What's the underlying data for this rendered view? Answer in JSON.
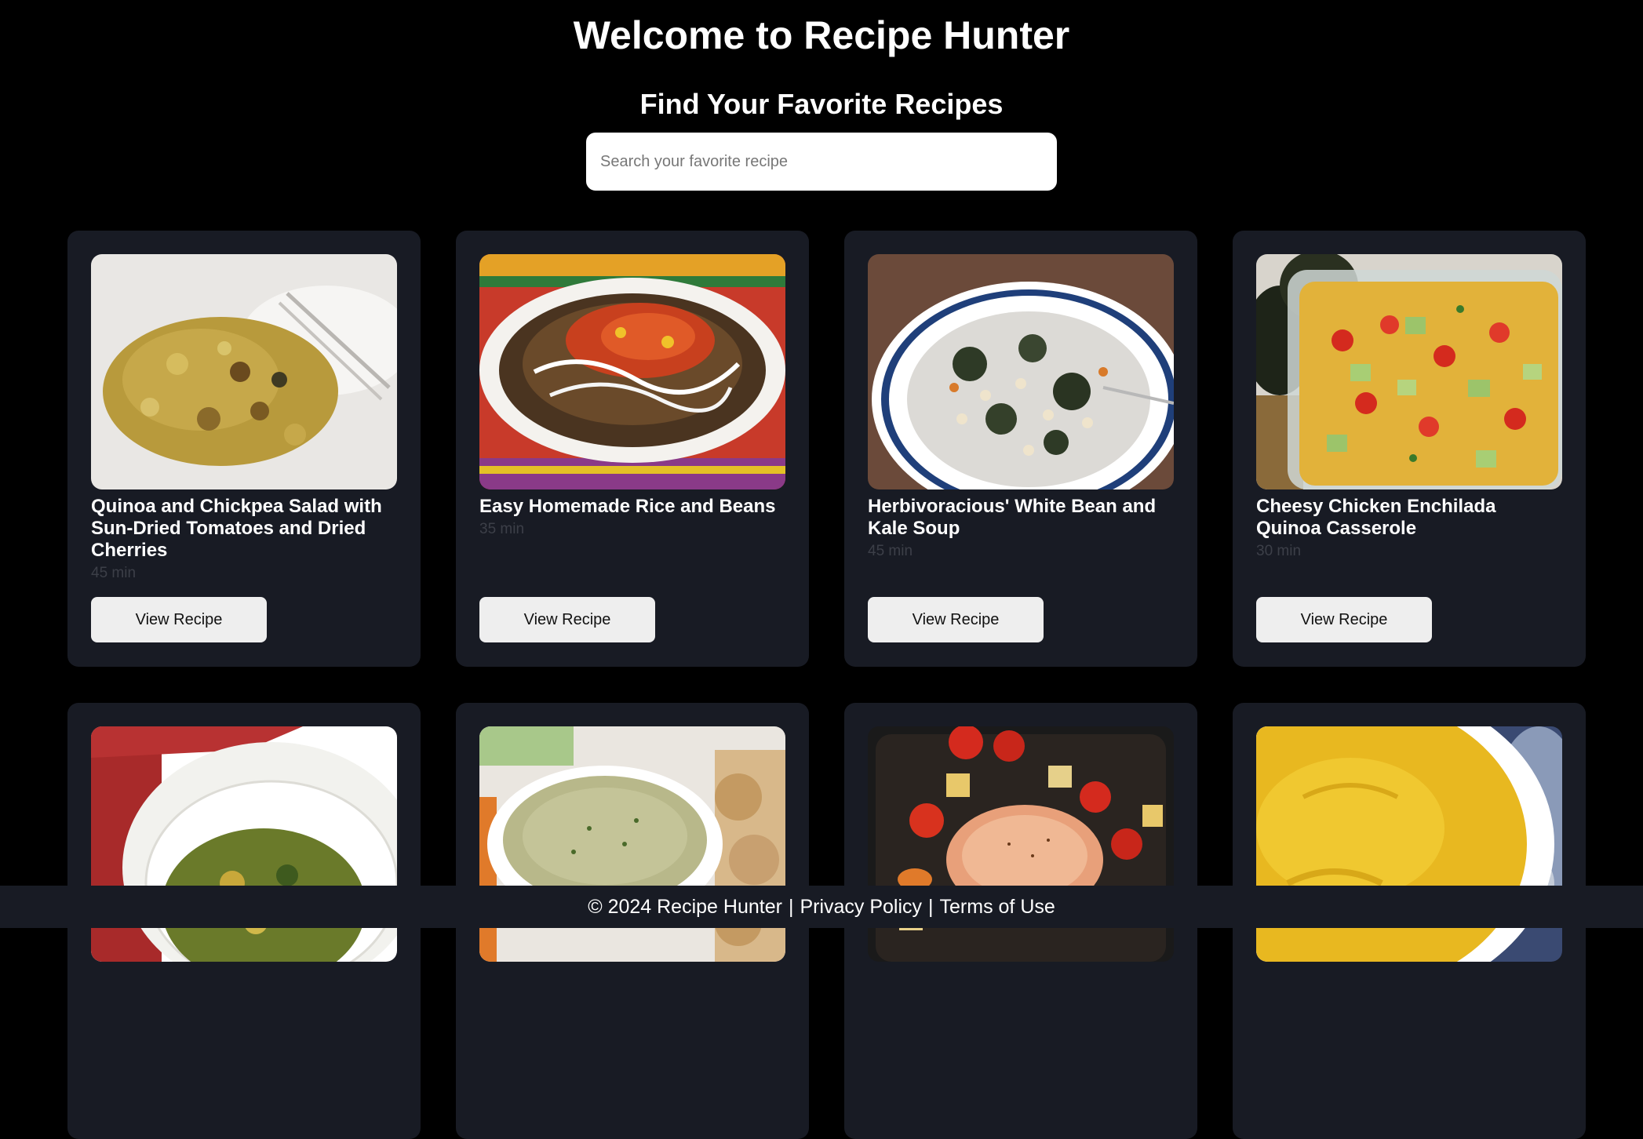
{
  "header": {
    "title": "Welcome to Recipe Hunter",
    "subtitle": "Find Your Favorite Recipes"
  },
  "search": {
    "placeholder": "Search your favorite recipe",
    "value": ""
  },
  "recipes": [
    {
      "title": "Quinoa and Chickpea Salad with Sun-Dried Tomatoes and Dried Cherries",
      "time": "45 min",
      "button": "View Recipe",
      "image": "quinoa-chickpea-salad-image"
    },
    {
      "title": "Easy Homemade Rice and Beans",
      "time": "35 min",
      "button": "View Recipe",
      "image": "rice-and-beans-image"
    },
    {
      "title": "Herbivoracious' White Bean and Kale Soup",
      "time": "45 min",
      "button": "View Recipe",
      "image": "white-bean-kale-soup-image"
    },
    {
      "title": "Cheesy Chicken Enchilada Quinoa Casserole",
      "time": "30 min",
      "button": "View Recipe",
      "image": "enchilada-casserole-image"
    },
    {
      "image": "greens-curry-image"
    },
    {
      "image": "hummus-dip-image"
    },
    {
      "image": "roasted-salmon-vegetables-image"
    },
    {
      "image": "squash-puree-image"
    }
  ],
  "footer": {
    "copyright": "© 2024 Recipe Hunter",
    "privacy": "Privacy Policy",
    "terms": "Terms of Use"
  },
  "colors": {
    "background": "#000000",
    "card": "#181b24",
    "muted_text": "#3c3f48",
    "button": "#eeeeee"
  }
}
